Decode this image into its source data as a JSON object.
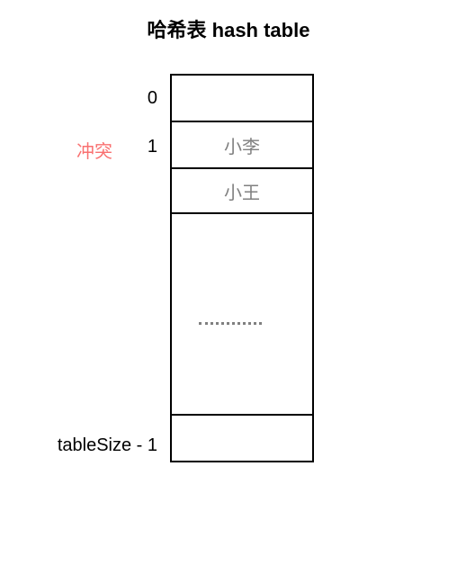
{
  "title": "哈希表 hash table",
  "labels": {
    "index0": "0",
    "index1": "1",
    "indexLast": "tableSize - 1",
    "collision": "冲突"
  },
  "cells": {
    "slot0": "",
    "slot1a": "小李",
    "slot1b": "小王",
    "slotLast": ""
  },
  "colors": {
    "collision": "#f97070",
    "cellText": "#808080"
  }
}
